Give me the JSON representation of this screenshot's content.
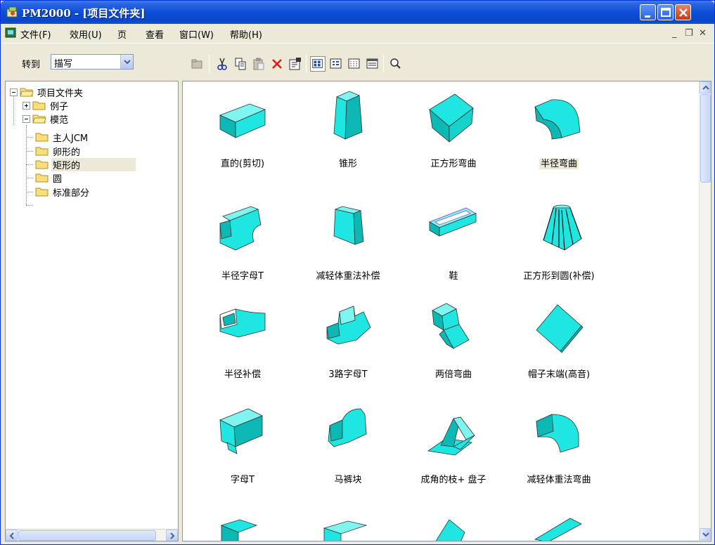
{
  "window": {
    "title": "PM2000 - [项目文件夹]"
  },
  "menu": {
    "items": [
      "文件(F)",
      "效用(U)",
      "页",
      "查看",
      "窗口(W)",
      "帮助(H)"
    ]
  },
  "toolbar": {
    "goto_label": "转到",
    "goto_value": "描写"
  },
  "tree": {
    "root": "项目文件夹",
    "examples": "例子",
    "templates": "模范",
    "children": [
      "主人JCM",
      "卵形的",
      "矩形的",
      "圆",
      "标准部分"
    ],
    "selected": "矩形的"
  },
  "tiles": [
    {
      "label": "直的(剪切)",
      "icon": "straight-duct-icon"
    },
    {
      "label": "锥形",
      "icon": "taper-icon"
    },
    {
      "label": "正方形弯曲",
      "icon": "square-elbow-icon"
    },
    {
      "label": "半径弯曲",
      "icon": "radius-elbow-icon"
    },
    {
      "label": "半径字母T",
      "icon": "radius-tee-icon"
    },
    {
      "label": "减轻体重法补偿",
      "icon": "offset-icon"
    },
    {
      "label": "鞋",
      "icon": "shoe-icon"
    },
    {
      "label": "正方形到圆(补偿)",
      "icon": "square-to-round-icon"
    },
    {
      "label": "半径补偿",
      "icon": "radius-offset-icon"
    },
    {
      "label": "3路字母T",
      "icon": "three-way-tee-icon"
    },
    {
      "label": "两倍弯曲",
      "icon": "double-bend-icon"
    },
    {
      "label": "帽子末端(高音)",
      "icon": "end-cap-icon"
    },
    {
      "label": "字母T",
      "icon": "tee-icon"
    },
    {
      "label": "马裤块",
      "icon": "breeches-icon"
    },
    {
      "label": "成角的枝+ 盘子",
      "icon": "angled-branch-icon"
    },
    {
      "label": "减轻体重法弯曲",
      "icon": "offset-bend-icon"
    }
  ],
  "colors": {
    "duct": "#1fe6e0",
    "duct_dark": "#0bb8b4",
    "titlebar": "#0a47c8"
  }
}
